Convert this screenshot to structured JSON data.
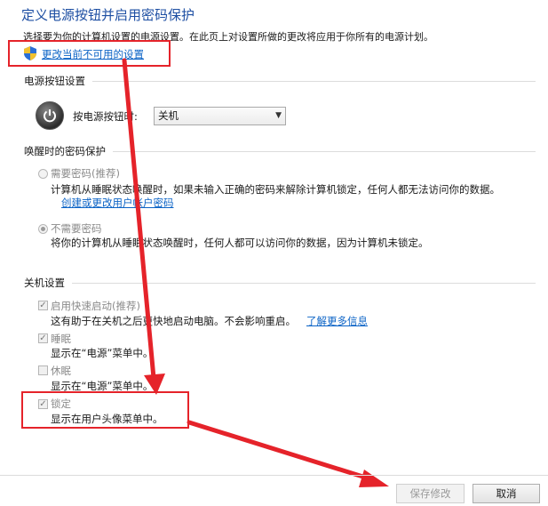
{
  "header": {
    "title": "定义电源按钮并启用密码保护",
    "description": "选择要为你的计算机设置的电源设置。在此页上对设置所做的更改将应用于你所有的电源计划。",
    "change_link": "更改当前不可用的设置"
  },
  "power_buttons": {
    "section_title": "电源按钮设置",
    "label": "按电源按钮时:",
    "selected": "关机"
  },
  "wake_password": {
    "section_title": "唤醒时的密码保护",
    "options": [
      {
        "label": "需要密码(推荐)",
        "description": "计算机从睡眠状态唤醒时，如果未输入正确的密码来解除计算机锁定，任何人都无法访问你的数据。",
        "link": "创建或更改用户帐户密码",
        "selected": false
      },
      {
        "label": "不需要密码",
        "description": "将你的计算机从睡眠状态唤醒时，任何人都可以访问你的数据，因为计算机未锁定。",
        "selected": true
      }
    ]
  },
  "shutdown": {
    "section_title": "关机设置",
    "items": [
      {
        "label": "启用快速启动(推荐)",
        "description": "这有助于在关机之后更快地启动电脑。不会影响重启。",
        "link": "了解更多信息",
        "checked": true
      },
      {
        "label": "睡眠",
        "description": "显示在“电源”菜单中。",
        "checked": true
      },
      {
        "label": "休眠",
        "description": "显示在“电源”菜单中。",
        "checked": false
      },
      {
        "label": "锁定",
        "description": "显示在用户头像菜单中。",
        "checked": true
      }
    ]
  },
  "footer": {
    "save_label": "保存修改",
    "cancel_label": "取消"
  },
  "colors": {
    "annotation": "#e5232a",
    "link": "#0b63c6",
    "title": "#1e4fa3"
  }
}
